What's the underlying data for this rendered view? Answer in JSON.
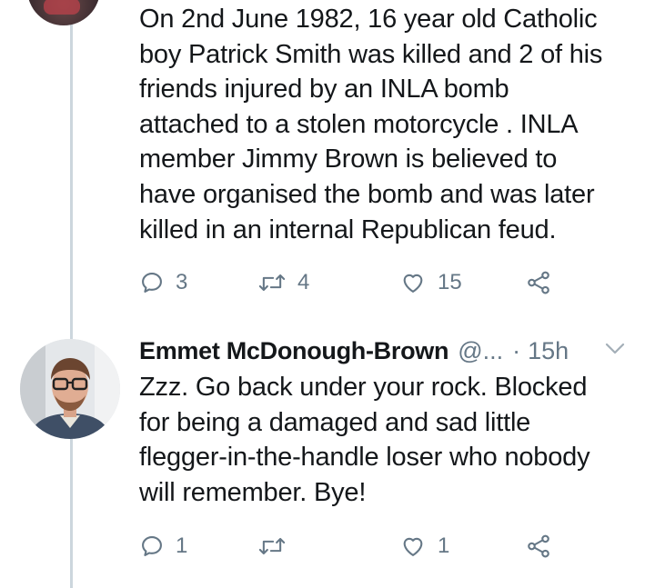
{
  "tweet1": {
    "lines": [
      "On 2nd June 1982, 16 year old Catholic",
      "boy Patrick Smith was killed and 2 of his",
      "friends injured by an INLA bomb",
      "attached to a stolen motorcycle .  INLA",
      "member Jimmy Brown is believed to",
      "have organised the bomb and was later",
      "killed in an internal Republican feud."
    ],
    "replies": "3",
    "retweets": "4",
    "likes": "15"
  },
  "tweet2": {
    "name": "Emmet McDonough-Brown",
    "handle": "@...",
    "separator": "·",
    "time": "15h",
    "lines": [
      "Zzz. Go back under your rock. Blocked",
      "for being a damaged and sad little",
      "flegger-in-the-handle loser who nobody",
      "will remember. Bye!"
    ],
    "replies": "1",
    "retweets": "",
    "likes": "1"
  },
  "colors": {
    "text": "#14171a",
    "secondary": "#657786",
    "thread_line": "#ccd6dd",
    "background": "#ffffff"
  },
  "icons": [
    "reply-icon",
    "retweet-icon",
    "like-icon",
    "share-icon",
    "chevron-down-icon"
  ]
}
